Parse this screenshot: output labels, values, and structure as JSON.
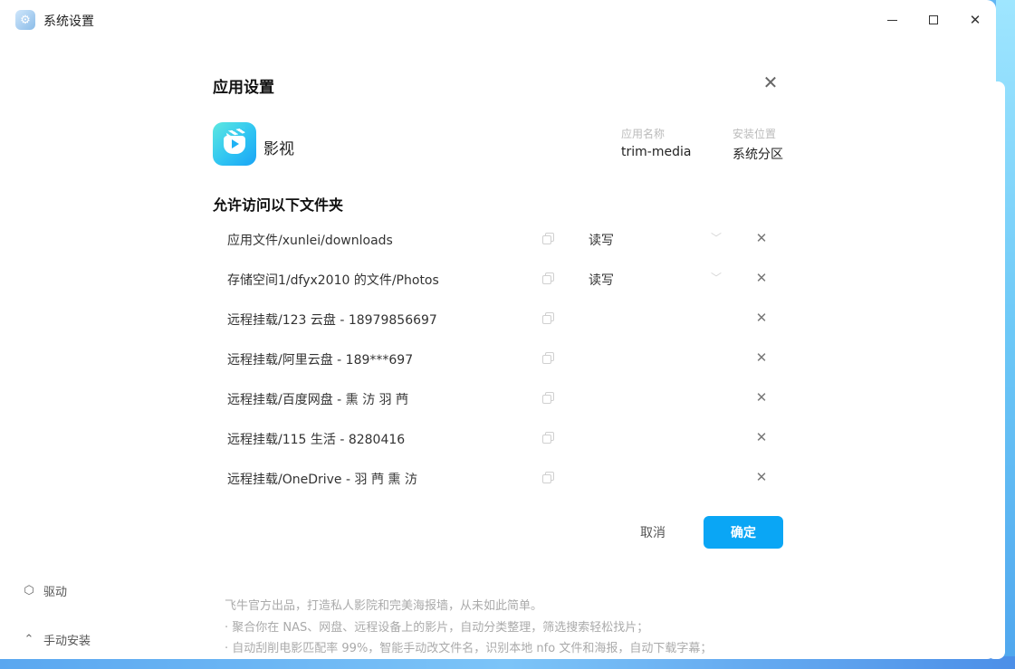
{
  "window": {
    "title": "系统设置",
    "icon": "settings-app-icon"
  },
  "sidebar": {
    "items": [
      {
        "label": "驱动",
        "icon": "cube-icon"
      },
      {
        "label": "手动安装",
        "icon": "upload-icon"
      }
    ]
  },
  "background_text": [
    "飞牛官方出品，打造私人影院和完美海报墙，从未如此简单。",
    "· 聚合你在 NAS、网盘、远程设备上的影片，自动分类整理，筛选搜索轻松找片；",
    "· 自动刮削电影匹配率 99%，智能手动改文件名，识别本地 nfo 文件和海报，自动下载字幕；"
  ],
  "dialog": {
    "title": "应用设置",
    "app_name": "影视",
    "meta": [
      {
        "label": "应用名称",
        "value": "trim-media"
      },
      {
        "label": "安装位置",
        "value": "系统分区"
      }
    ],
    "section_title": "允许访问以下文件夹",
    "folders": [
      {
        "path": "应用文件/xunlei/downloads",
        "permission": "读写"
      },
      {
        "path": "存储空间1/dfyx2010 的文件/Photos",
        "permission": "读写"
      },
      {
        "path": "远程挂载/123 云盘 - 18979856697",
        "permission": ""
      },
      {
        "path": "远程挂载/阿里云盘 - 189***697",
        "permission": ""
      },
      {
        "path": "远程挂载/百度网盘 - 熏 汸 羽 菛",
        "permission": ""
      },
      {
        "path": "远程挂载/115 生活 - 8280416",
        "permission": ""
      },
      {
        "path": "远程挂载/OneDrive - 羽 菛 熏 汸",
        "permission": ""
      }
    ],
    "cancel_label": "取消",
    "confirm_label": "确定"
  },
  "colors": {
    "accent": "#0aa6f5",
    "background": "#4aa8ef"
  }
}
